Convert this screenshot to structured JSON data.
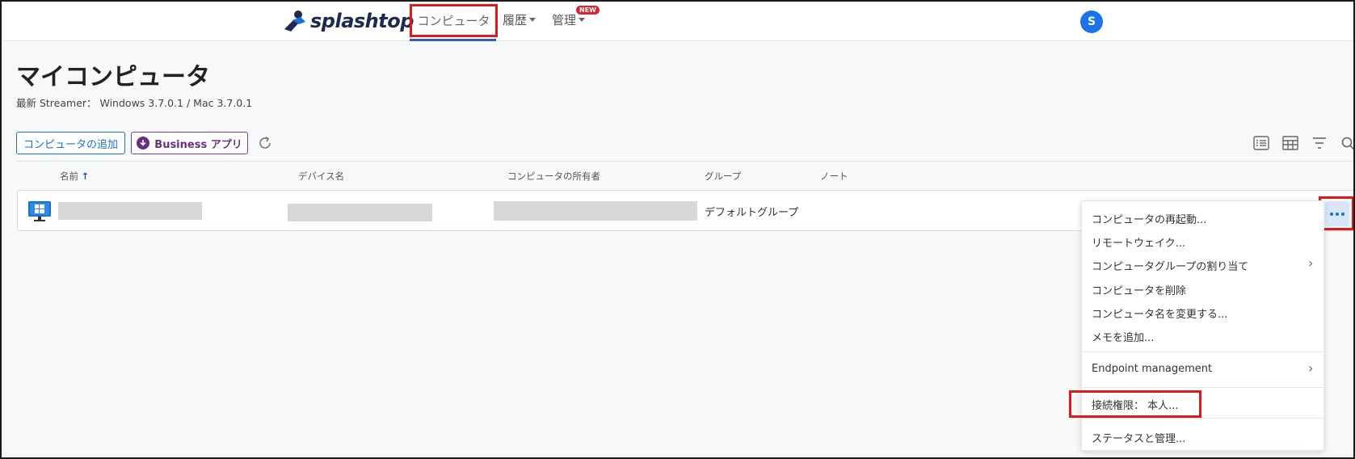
{
  "nav": {
    "logo_text": "splashtop",
    "computers": "コンピュータ",
    "history": "履歴",
    "manage": "管理",
    "new_badge": "NEW",
    "avatar_initial": "S"
  },
  "page": {
    "title": "マイコンピュータ",
    "subtitle": "最新 Streamer： Windows 3.7.0.1 / Mac 3.7.0.1"
  },
  "toolbar": {
    "add_computer": "コンピュータの追加",
    "business_app": "Business アプリ"
  },
  "table": {
    "columns": {
      "name": "名前",
      "device": "デバイス名",
      "owner": "コンピュータの所有者",
      "group": "グループ",
      "note": "ノート"
    },
    "rows": [
      {
        "group": "デフォルトグループ"
      }
    ]
  },
  "menu": {
    "items": [
      "コンピュータの再起動...",
      "リモートウェイク...",
      "コンピュータグループの割り当て",
      "コンピュータを削除",
      "コンピュータ名を変更する...",
      "メモを追加...",
      "Endpoint management",
      "接続権限： 本人...",
      "ステータスと管理..."
    ]
  },
  "colors": {
    "accent": "#1a6fd8",
    "business": "#6b2e82",
    "highlight": "#e01a1a",
    "avatar": "#1a73e8"
  }
}
